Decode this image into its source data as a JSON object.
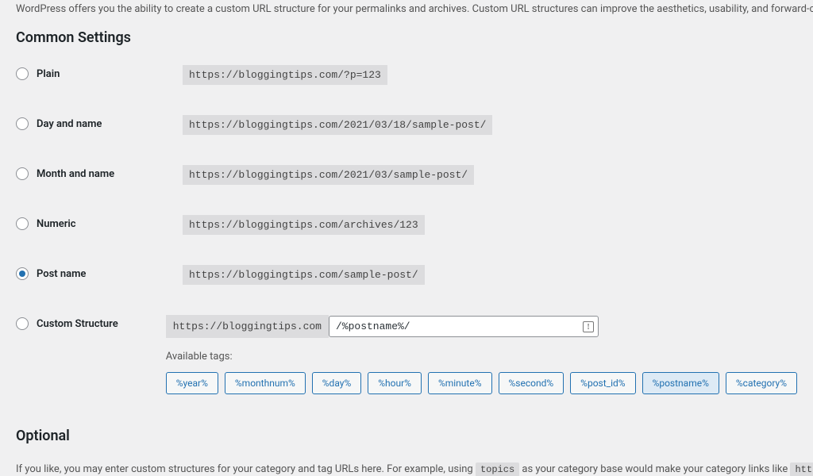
{
  "intro": "WordPress offers you the ability to create a custom URL structure for your permalinks and archives. Custom URL structures can improve the aesthetics, usability, and forward-compat",
  "sections": {
    "common": "Common Settings",
    "optional": "Optional"
  },
  "options": {
    "plain": {
      "label": "Plain",
      "example": "https://bloggingtips.com/?p=123"
    },
    "day_name": {
      "label": "Day and name",
      "example": "https://bloggingtips.com/2021/03/18/sample-post/"
    },
    "month_name": {
      "label": "Month and name",
      "example": "https://bloggingtips.com/2021/03/sample-post/"
    },
    "numeric": {
      "label": "Numeric",
      "example": "https://bloggingtips.com/archives/123"
    },
    "post_name": {
      "label": "Post name",
      "example": "https://bloggingtips.com/sample-post/"
    },
    "custom": {
      "label": "Custom Structure",
      "base_url": "https://bloggingtips.com",
      "value": "/%postname%/"
    }
  },
  "available_tags_label": "Available tags:",
  "tags": [
    "%year%",
    "%monthnum%",
    "%day%",
    "%hour%",
    "%minute%",
    "%second%",
    "%post_id%",
    "%postname%",
    "%category%"
  ],
  "active_tag": "%postname%",
  "optional_desc_parts": {
    "p1": "If you like, you may enter custom structures for your category and tag URLs here. For example, using ",
    "code1": "topics",
    "p2": " as your category base would make your category links like ",
    "code2": "https://"
  }
}
